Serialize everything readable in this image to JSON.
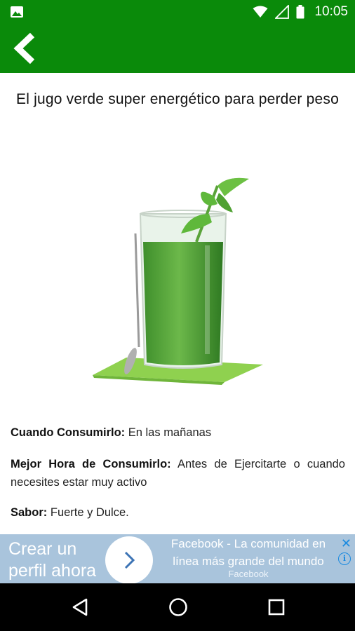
{
  "status_bar": {
    "time": "10:05",
    "icons": [
      "image-icon",
      "wifi-icon",
      "signal-icon",
      "battery-icon"
    ]
  },
  "app_bar": {
    "back_icon": "chevron-left-icon",
    "color": "#0a8a0a"
  },
  "article": {
    "title": "El jugo verde super energético para perder peso",
    "image": "green-smoothie-glass-illustration",
    "details": [
      {
        "label": "Cuando Consumirlo:",
        "value": "En las mañanas"
      },
      {
        "label": "Mejor Hora de Consumirlo:",
        "value": "Antes de Ejercitarte o cuando necesites estar muy activo"
      },
      {
        "label": "Sabor:",
        "value": "Fuerte y Dulce."
      }
    ]
  },
  "ad": {
    "cta": "Crear un perfil ahora",
    "text": "Facebook - La comunidad en línea más grande del mundo",
    "source": "Facebook",
    "close_label": "✕",
    "info_label": "i",
    "background": "#a9c4dc"
  },
  "nav_bar": {
    "icons": [
      "back-triangle-icon",
      "home-circle-icon",
      "recents-square-icon"
    ]
  }
}
